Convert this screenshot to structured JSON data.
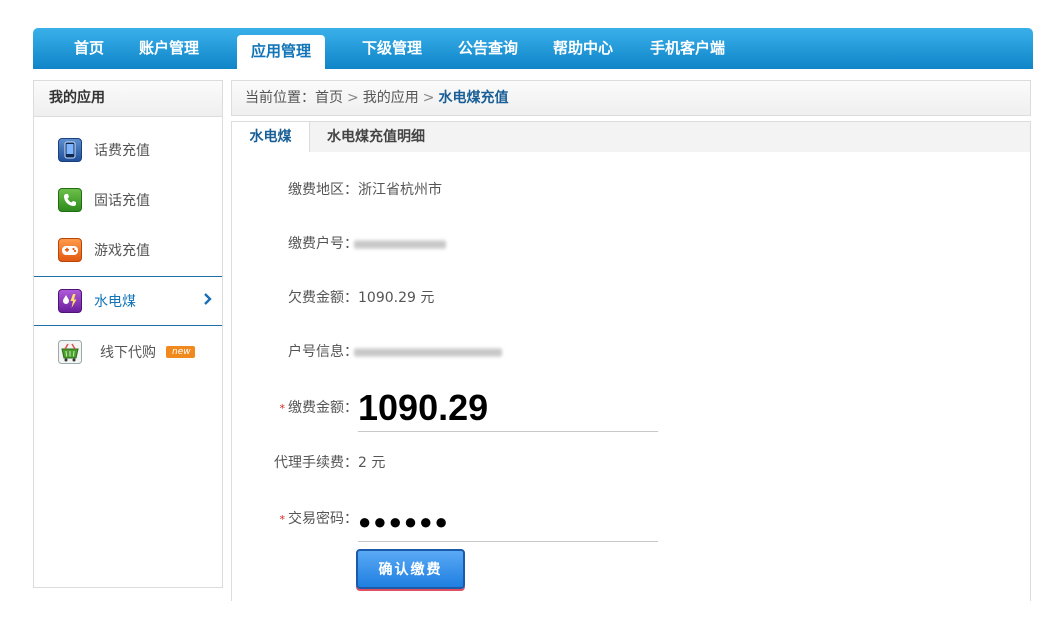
{
  "nav": {
    "items": [
      "首页",
      "账户管理",
      "应用管理",
      "下级管理",
      "公告查询",
      "帮助中心",
      "手机客户端"
    ],
    "active_index": 2
  },
  "sidebar": {
    "title": "我的应用",
    "items": [
      {
        "label": "话费充值",
        "icon": "phone-icon"
      },
      {
        "label": "固话充值",
        "icon": "telephone-icon"
      },
      {
        "label": "游戏充值",
        "icon": "game-icon"
      },
      {
        "label": "水电煤",
        "icon": "utility-icon"
      },
      {
        "label": "线下代购",
        "icon": "shopping-basket-icon",
        "badge": "new"
      }
    ],
    "active_index": 3
  },
  "breadcrumb": {
    "prefix": "当前位置：",
    "items": [
      "首页",
      "我的应用"
    ],
    "current": "水电煤充值",
    "sep": ">"
  },
  "tabs": {
    "active": "水电煤",
    "other": "水电煤充值明细"
  },
  "form": {
    "region_label": "缴费地区：",
    "region_value": "浙江省杭州市",
    "account_label": "缴费户号：",
    "arrears_label": "欠费金额：",
    "arrears_value": "1090.29 元",
    "info_label": "户号信息：",
    "amount_required": "*",
    "amount_label": "缴费金额：",
    "amount_value": "1090.29",
    "fee_label": "代理手续费：",
    "fee_value": "2 元",
    "pwd_required": "*",
    "pwd_label": "交易密码：",
    "pwd_value": "●●●●●●",
    "submit_label": "确认缴费"
  },
  "colors": {
    "nav_blue": "#1a8fd6",
    "active_text": "#1275b8",
    "required": "#e02020"
  }
}
